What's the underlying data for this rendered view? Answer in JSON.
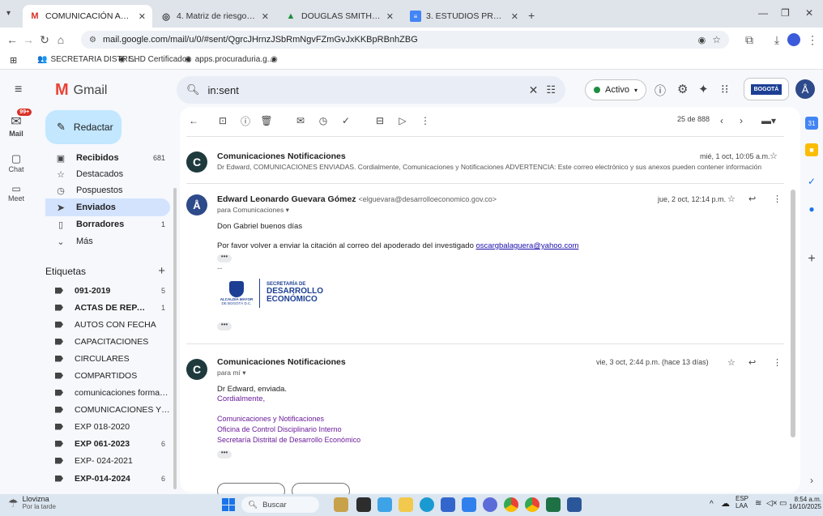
{
  "tabs": [
    {
      "label": "COMUNICACIÓN AUTO DE PR",
      "icon": "gmail-icon",
      "active": true
    },
    {
      "label": "4. Matriz de riesgos CPS (1).pdf",
      "icon": "chrome-icon"
    },
    {
      "label": "DOUGLAS SMITH CANO MORE",
      "icon": "drive-icon"
    },
    {
      "label": "3. ESTUDIOS PREVIOS FELIX M",
      "icon": "docs-icon"
    }
  ],
  "browser": {
    "url": "mail.google.com/mail/u/0/#sent/QgrcJHrnzJSbRmNgvFZmGvJxKKBpRBnhZBG"
  },
  "bookmarks": [
    "SECRETARIA DISTRI...",
    "SHD Certificados",
    "apps.procuraduria.g..."
  ],
  "gmail": {
    "logo": "Gmail",
    "search_value": "in:sent",
    "status": "Activo",
    "brand_badge": "BOGOTÁ"
  },
  "rail": {
    "mail": "Mail",
    "mail_badge": "99+",
    "chat": "Chat",
    "meet": "Meet"
  },
  "sidebar": {
    "compose": "Redactar",
    "items": [
      {
        "label": "Recibidos",
        "count": "681",
        "bold": true
      },
      {
        "label": "Destacados",
        "count": ""
      },
      {
        "label": "Pospuestos",
        "count": ""
      },
      {
        "label": "Enviados",
        "count": "",
        "active": true
      },
      {
        "label": "Borradores",
        "count": "1",
        "bold": true
      },
      {
        "label": "Más",
        "count": ""
      }
    ],
    "labels_title": "Etiquetas",
    "labels": [
      {
        "label": "091-2019",
        "count": "5",
        "bold": true
      },
      {
        "label": "ACTAS DE REPARTO",
        "count": "1",
        "bold": true
      },
      {
        "label": "AUTOS CON FECHA",
        "count": ""
      },
      {
        "label": "CAPACITACIONES",
        "count": ""
      },
      {
        "label": "CIRCULARES",
        "count": ""
      },
      {
        "label": "COMPARTIDOS",
        "count": ""
      },
      {
        "label": "comunicaciones formato...",
        "count": ""
      },
      {
        "label": "COMUNICACIONES Y/O ...",
        "count": ""
      },
      {
        "label": "EXP 018-2020",
        "count": ""
      },
      {
        "label": "EXP 061-2023",
        "count": "6",
        "bold": true
      },
      {
        "label": "EXP- 024-2021",
        "count": ""
      },
      {
        "label": "EXP-014-2024",
        "count": "6",
        "bold": true
      }
    ]
  },
  "toolbar": {
    "pagination": "25 de 888"
  },
  "thread": {
    "m1": {
      "avatar": "C",
      "from": "Comunicaciones Notificaciones",
      "date": "mié, 1 oct, 10:05 a.m.",
      "snippet": "Dr Edward, COMUNICACIONES ENVIADAS. Cordialmente, Comunicaciones y Notificaciones ADVERTENCIA: Este correo electrónico y sus anexos pueden contener información"
    },
    "m2": {
      "from": "Edward Leonardo Guevara Gómez",
      "email": "<elguevara@desarrolloeconomico.gov.co>",
      "to": "para Comunicaciones",
      "date": "jue, 2 oct, 12:14 p.m.",
      "greeting": "Don Gabriel buenos días",
      "body": "Por favor volver a enviar la citación al correo del apoderado del investigado",
      "link": "oscargbalaguera@yahoo.com",
      "sig_line": "--",
      "sig_left1": "ALCALDÍA MAYOR",
      "sig_left2": "DE BOGOTÁ D.C.",
      "sig_right1": "SECRETARÍA DE",
      "sig_right2": "DESARROLLO",
      "sig_right3": "ECONÓMICO"
    },
    "m3": {
      "avatar": "C",
      "from": "Comunicaciones Notificaciones",
      "to": "para mí",
      "date": "vie, 3 oct, 2:44 p.m. (hace 13 días)",
      "line1": "Dr Edward, enviada.",
      "line2": "Cordialmente,",
      "sig1": "Comunicaciones y Notificaciones",
      "sig2": "Oficina de Control Disciplinario Interno",
      "sig3": "Secretaría Distrital de Desarrollo Económico"
    }
  },
  "taskbar": {
    "weather_title": "Llovizna",
    "weather_sub": "Por la tarde",
    "search": "Buscar",
    "lang1": "ESP",
    "lang2": "LAA",
    "time": "8:54 a.m.",
    "date": "16/10/2025"
  }
}
